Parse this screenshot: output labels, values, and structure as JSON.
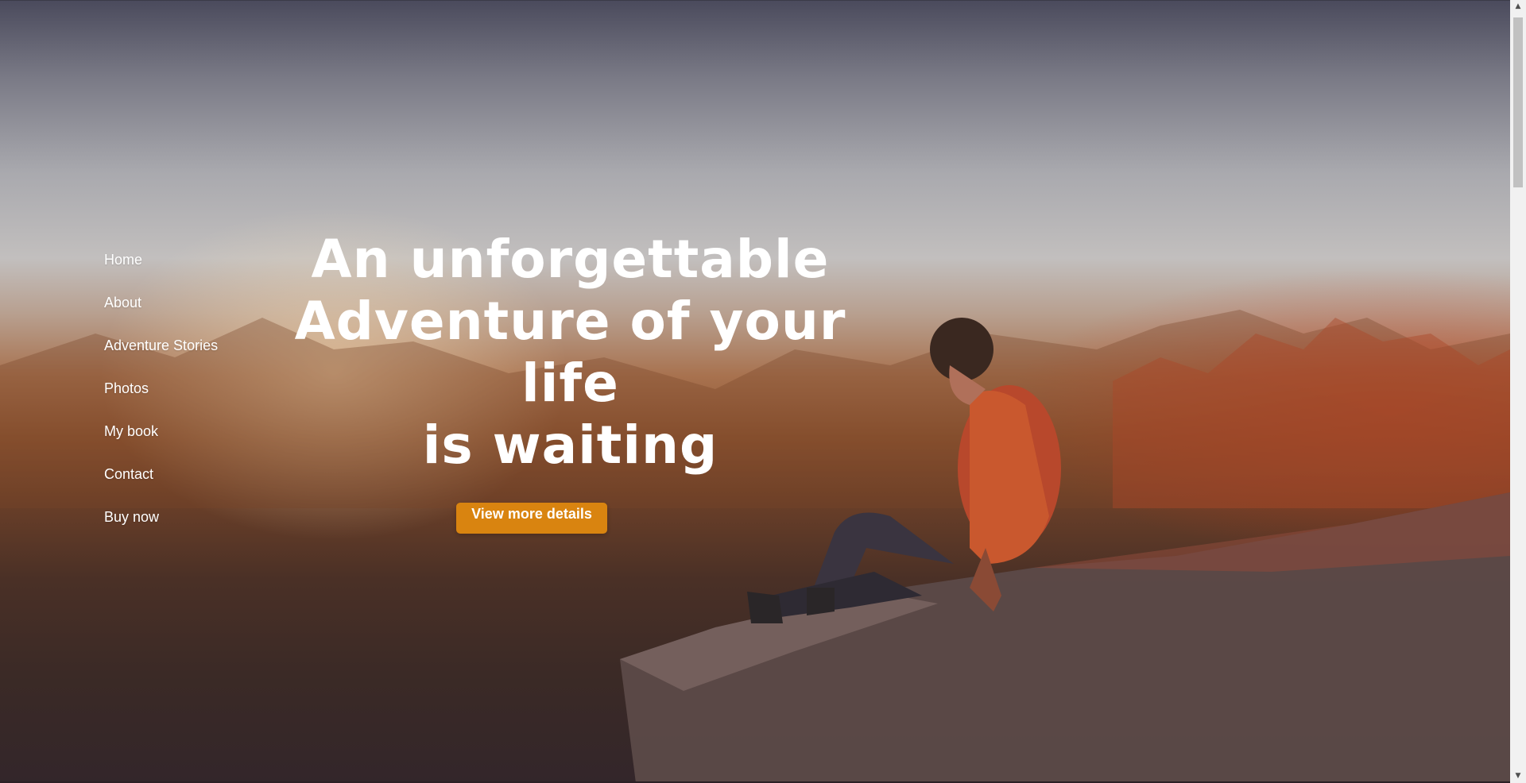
{
  "nav": {
    "items": [
      {
        "label": "Home"
      },
      {
        "label": "About"
      },
      {
        "label": "Adventure Stories"
      },
      {
        "label": "Photos"
      },
      {
        "label": "My book"
      },
      {
        "label": "Contact"
      },
      {
        "label": "Buy now"
      }
    ]
  },
  "hero": {
    "headline_line1": "An unforgettable",
    "headline_line2": "Adventure of your life",
    "headline_line3": "is waiting",
    "cta_label": "View more details",
    "background_image": "person-sitting-on-cliff-at-sunset",
    "accent_color": "#d98410"
  },
  "scrollbar": {
    "up_icon": "scroll-up-arrow-icon",
    "down_icon": "scroll-down-arrow-icon"
  }
}
